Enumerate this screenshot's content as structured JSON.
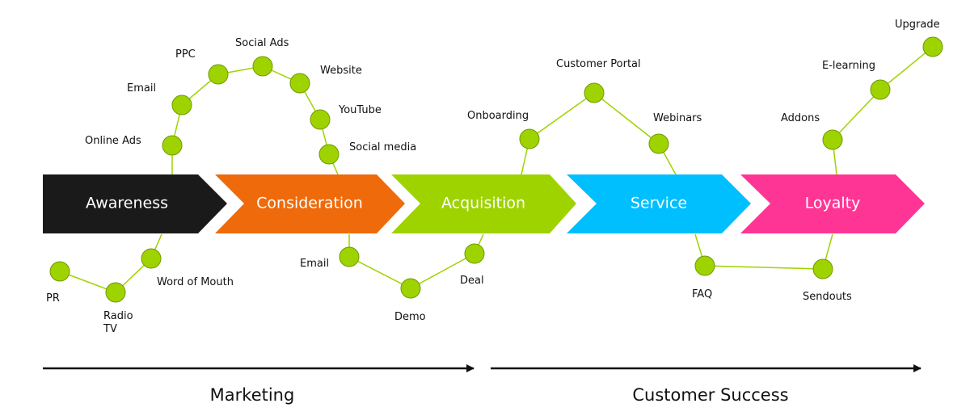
{
  "colors": {
    "awareness": "#1a1a1a",
    "consideration": "#ef6a0a",
    "acquisition": "#9ed300",
    "service": "#00bfff",
    "loyalty": "#ff3595",
    "node": "#9ed300"
  },
  "stages": [
    {
      "label": "Awareness"
    },
    {
      "label": "Consideration"
    },
    {
      "label": "Acquisition"
    },
    {
      "label": "Service"
    },
    {
      "label": "Loyalty"
    }
  ],
  "nodes": {
    "online_ads": "Online Ads",
    "email_top": "Email",
    "ppc": "PPC",
    "social_ads": "Social Ads",
    "website": "Website",
    "youtube": "YouTube",
    "social_media": "Social media",
    "word_of_mouth": "Word of Mouth",
    "radio": "Radio",
    "tv": "TV",
    "pr": "PR",
    "email_bottom": "Email",
    "demo": "Demo",
    "deal": "Deal",
    "onboarding": "Onboarding",
    "customer_portal": "Customer Portal",
    "webinars": "Webinars",
    "faq": "FAQ",
    "sendouts": "Sendouts",
    "addons": "Addons",
    "e_learning": "E-learning",
    "upgrade": "Upgrade"
  },
  "phases": {
    "marketing": "Marketing",
    "customer_success": "Customer Success"
  }
}
